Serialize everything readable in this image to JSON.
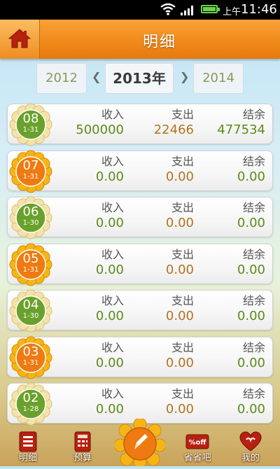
{
  "status": {
    "ampm": "上午",
    "time": "11:46"
  },
  "header": {
    "title": "明细"
  },
  "years": {
    "prev": "2012",
    "current": "2013年",
    "next": "2014"
  },
  "labels": {
    "income": "收入",
    "expense": "支出",
    "balance": "结余"
  },
  "months": [
    {
      "month": "08",
      "range": "1-31",
      "income": "500000",
      "expense": "22466",
      "balance": "477534",
      "flower": "green"
    },
    {
      "month": "07",
      "range": "1-31",
      "income": "0.00",
      "expense": "0.00",
      "balance": "0.00",
      "flower": "orange"
    },
    {
      "month": "06",
      "range": "1-30",
      "income": "0.00",
      "expense": "0.00",
      "balance": "0.00",
      "flower": "green"
    },
    {
      "month": "05",
      "range": "1-31",
      "income": "0.00",
      "expense": "0.00",
      "balance": "0.00",
      "flower": "orange"
    },
    {
      "month": "04",
      "range": "1-30",
      "income": "0.00",
      "expense": "0.00",
      "balance": "0.00",
      "flower": "green"
    },
    {
      "month": "03",
      "range": "1-31",
      "income": "0.00",
      "expense": "0.00",
      "balance": "0.00",
      "flower": "orange"
    },
    {
      "month": "02",
      "range": "1-28",
      "income": "0.00",
      "expense": "0.00",
      "balance": "0.00",
      "flower": "green"
    }
  ],
  "nav": {
    "detail": "明细",
    "budget": "预算",
    "save": "省省吧",
    "mine": "我的"
  },
  "colors": {
    "accent": "#f08a1a",
    "income": "#5d8a1a",
    "expense": "#b4731e",
    "flower_green": "#6aa12c",
    "flower_orange": "#ef7a12"
  }
}
